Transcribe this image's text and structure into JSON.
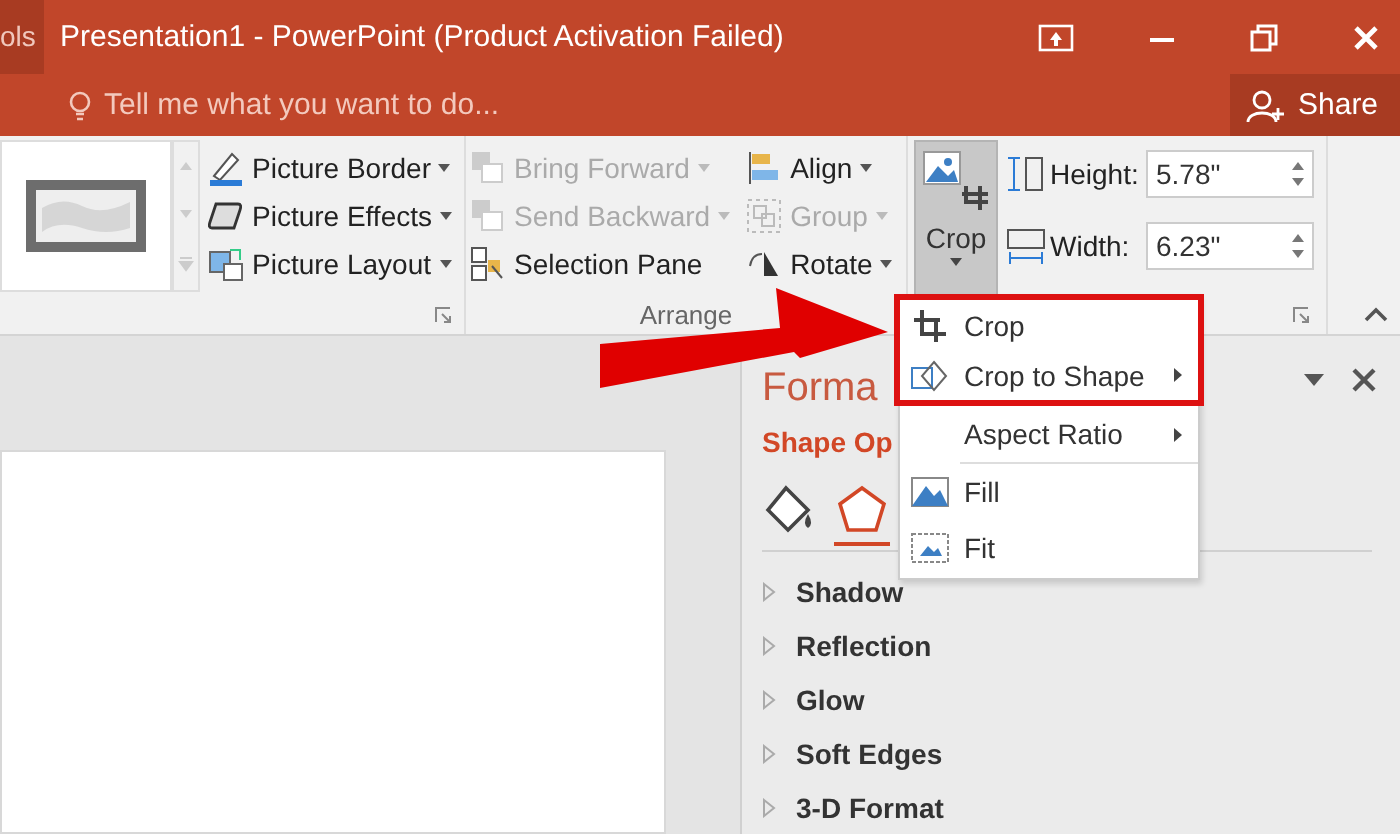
{
  "title_bar": {
    "tab_fragment": "ols",
    "title": "Presentation1 - PowerPoint (Product Activation Failed)"
  },
  "tell_me": {
    "placeholder": "Tell me what you want to do..."
  },
  "share_button": {
    "label": "Share"
  },
  "ribbon": {
    "picture_commands": [
      {
        "label": "Picture Border",
        "kind": "border",
        "dropdown": true
      },
      {
        "label": "Picture Effects",
        "kind": "effects",
        "dropdown": true
      },
      {
        "label": "Picture Layout",
        "kind": "layout",
        "dropdown": true
      }
    ],
    "arrange_columns": [
      [
        {
          "label": "Bring Forward",
          "kind": "forward",
          "dropdown": true,
          "disabled": true
        },
        {
          "label": "Send Backward",
          "kind": "backward",
          "dropdown": true,
          "disabled": true
        },
        {
          "label": "Selection Pane",
          "kind": "pane",
          "dropdown": false,
          "disabled": false
        }
      ],
      [
        {
          "label": "Align",
          "kind": "align",
          "dropdown": true,
          "disabled": false
        },
        {
          "label": "Group",
          "kind": "group",
          "dropdown": true,
          "disabled": true
        },
        {
          "label": "Rotate",
          "kind": "rotate",
          "dropdown": true,
          "disabled": false
        }
      ]
    ],
    "arrange_label": "Arrange",
    "crop_button": {
      "label": "Crop",
      "selected": true
    },
    "size": [
      {
        "label": "Height:",
        "kind": "height",
        "value": "5.78\""
      },
      {
        "label": "Width:",
        "kind": "width",
        "value": "6.23\""
      }
    ]
  },
  "format_pane": {
    "title": "Forma",
    "subtitle": "Shape Op",
    "tabs": [
      {
        "kind": "fill",
        "selected": false
      },
      {
        "kind": "effects",
        "selected": true
      }
    ],
    "sections": [
      "Shadow",
      "Reflection",
      "Glow",
      "Soft Edges",
      "3-D Format"
    ]
  },
  "crop_menu": {
    "highlighted_items": [
      {
        "label": "Crop",
        "kind": "crop",
        "submenu": false
      },
      {
        "label": "Crop to Shape",
        "kind": "shape",
        "submenu": true
      }
    ],
    "items": [
      {
        "label": "Aspect Ratio",
        "kind": "none",
        "submenu": true
      },
      {
        "label": "Fill",
        "kind": "fill",
        "submenu": false
      },
      {
        "label": "Fit",
        "kind": "fit",
        "submenu": false
      }
    ]
  }
}
